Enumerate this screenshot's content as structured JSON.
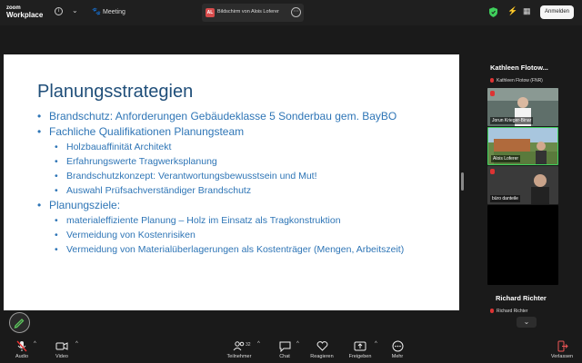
{
  "app": {
    "logo_line1": "zoom",
    "logo_line2": "Workplace"
  },
  "topbar": {
    "meeting_label": "Meeting",
    "share_tab": {
      "avatar_initials": "AL",
      "label": "Bildschirm von Alois Loferer"
    },
    "signin_label": "Anmelden",
    "colors": {
      "shield": "#3fcf5c",
      "avatar": "#d84c4c"
    }
  },
  "slide": {
    "title": "Planungsstrategien",
    "bullets": [
      {
        "level": 1,
        "text": "Brandschutz: Anforderungen Gebäudeklasse 5 Sonderbau gem. BayBO"
      },
      {
        "level": 1,
        "text": "Fachliche Qualifikationen Planungsteam"
      },
      {
        "level": 2,
        "text": "Holzbauaffinität Architekt"
      },
      {
        "level": 2,
        "text": "Erfahrungswerte Tragwerksplanung"
      },
      {
        "level": 2,
        "text": "Brandschutzkonzept: Verantwortungsbewusstsein und Mut!"
      },
      {
        "level": 2,
        "text": "Auswahl Prüfsachverständiger Brandschutz"
      },
      {
        "level": 1,
        "text": "Planungsziele:"
      },
      {
        "level": 2,
        "text": "materialeffiziente Planung – Holz im Einsatz als Tragkonstruktion"
      },
      {
        "level": 2,
        "text": "Vermeidung von Kostenrisiken"
      },
      {
        "level": 2,
        "text": "Vermeidung von Materialüberlagerungen als Kostenträger (Mengen, Arbeitszeit)"
      }
    ],
    "colors": {
      "title": "#1f4e79",
      "text": "#2e75b6"
    }
  },
  "participants": {
    "top_name": "Kathleen Flotow...",
    "tiles": [
      {
        "label": "Kathleen Flotow (FNR)"
      },
      {
        "label": "Jorun Krieger-Binar"
      },
      {
        "label": "Alois Loferer"
      },
      {
        "label": "büro danteile"
      }
    ],
    "bottom_name": "Richard Richter",
    "bottom_label": "Richard Richter"
  },
  "toolbar": {
    "audio": "Audio",
    "video": "Video",
    "participants": "Teilnehmer",
    "participants_count": "32",
    "chat": "Chat",
    "react": "Reagieren",
    "share": "Freigeben",
    "more": "Mehr",
    "leave": "Verlassen"
  }
}
